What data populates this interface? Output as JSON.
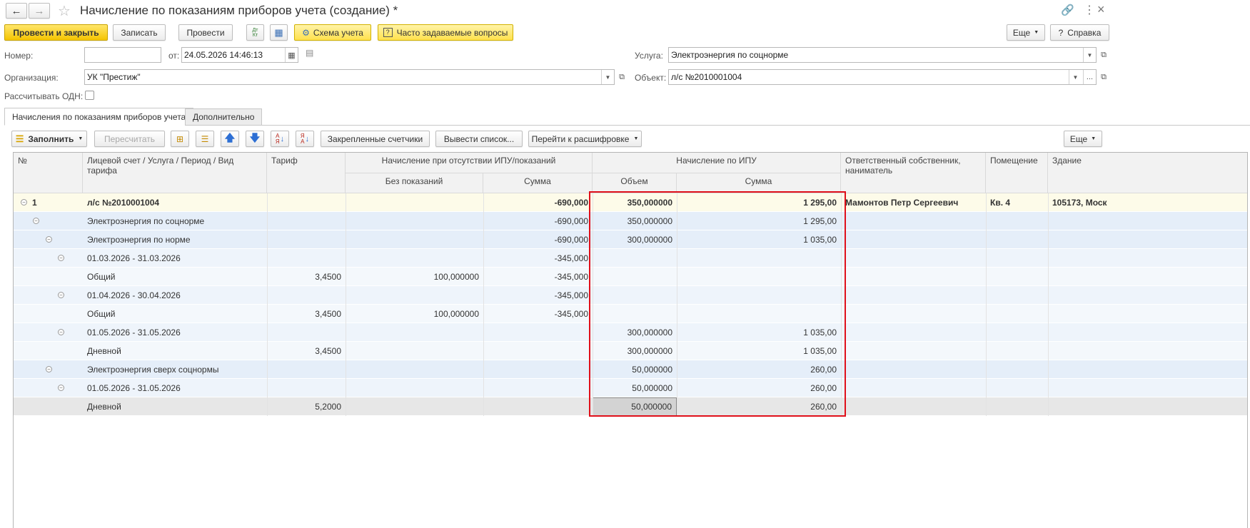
{
  "window": {
    "title": "Начисление по показаниям приборов учета (создание) *"
  },
  "toolbar": {
    "post_close": "Провести и закрыть",
    "save": "Записать",
    "post": "Провести",
    "scheme": "Схема учета",
    "faq": "Часто задаваемые вопросы",
    "more": "Еще",
    "help": "Справка"
  },
  "form": {
    "number_label": "Номер:",
    "number_value": "",
    "date_label": "от:",
    "date_value": "24.05.2026 14:46:13",
    "org_label": "Организация:",
    "org_value": "УК \"Престиж\"",
    "odn_label": "Рассчитывать ОДН:",
    "service_label": "Услуга:",
    "service_value": "Электроэнергия по соцнорме",
    "object_label": "Объект:",
    "object_value": "л/с №2010001004"
  },
  "tabs": [
    "Начисления по показаниям приборов учета",
    "Дополнительно"
  ],
  "table_toolbar": {
    "fill": "Заполнить",
    "recalc": "Пересчитать",
    "fixed_meters": "Закрепленные счетчики",
    "export_list": "Вывести список...",
    "go_decode": "Перейти к расшифровке",
    "more": "Еще"
  },
  "columns": {
    "num": "№",
    "account": "Лицевой счет / Услуга / Период / Вид тарифа",
    "tariff": "Тариф",
    "group_no_meter": "Начисление при отсутствии ИПУ/показаний",
    "no_readings": "Без показаний",
    "sum1": "Сумма",
    "group_ipu": "Начисление по ИПУ",
    "volume": "Объем",
    "sum2": "Сумма",
    "owner": "Ответственный собственник, наниматель",
    "room": "Помещение",
    "building": "Здание"
  },
  "rows": [
    {
      "num": "1",
      "text": "л/с №2010001004",
      "tariff": "",
      "no_readings": "",
      "sum1": "-690,000",
      "volume": "350,000000",
      "sum2": "1 295,00",
      "owner": "Мамонтов Петр Сергеевич",
      "room": "Кв. 4",
      "building": "105173, Моск"
    },
    {
      "num": "",
      "text": "Электроэнергия по соцнорме",
      "tariff": "",
      "no_readings": "",
      "sum1": "-690,000",
      "volume": "350,000000",
      "sum2": "1 295,00",
      "owner": "",
      "room": "",
      "building": ""
    },
    {
      "num": "",
      "text": "Электроэнергия по норме",
      "tariff": "",
      "no_readings": "",
      "sum1": "-690,000",
      "volume": "300,000000",
      "sum2": "1 035,00",
      "owner": "",
      "room": "",
      "building": ""
    },
    {
      "num": "",
      "text": "01.03.2026 - 31.03.2026",
      "tariff": "",
      "no_readings": "",
      "sum1": "-345,000",
      "volume": "",
      "sum2": "",
      "owner": "",
      "room": "",
      "building": ""
    },
    {
      "num": "",
      "text": "Общий",
      "tariff": "3,4500",
      "no_readings": "100,000000",
      "sum1": "-345,000",
      "volume": "",
      "sum2": "",
      "owner": "",
      "room": "",
      "building": ""
    },
    {
      "num": "",
      "text": "01.04.2026 - 30.04.2026",
      "tariff": "",
      "no_readings": "",
      "sum1": "-345,000",
      "volume": "",
      "sum2": "",
      "owner": "",
      "room": "",
      "building": ""
    },
    {
      "num": "",
      "text": "Общий",
      "tariff": "3,4500",
      "no_readings": "100,000000",
      "sum1": "-345,000",
      "volume": "",
      "sum2": "",
      "owner": "",
      "room": "",
      "building": ""
    },
    {
      "num": "",
      "text": "01.05.2026 - 31.05.2026",
      "tariff": "",
      "no_readings": "",
      "sum1": "",
      "volume": "300,000000",
      "sum2": "1 035,00",
      "owner": "",
      "room": "",
      "building": ""
    },
    {
      "num": "",
      "text": "Дневной",
      "tariff": "3,4500",
      "no_readings": "",
      "sum1": "",
      "volume": "300,000000",
      "sum2": "1 035,00",
      "owner": "",
      "room": "",
      "building": ""
    },
    {
      "num": "",
      "text": "Электроэнергия сверх соцнормы",
      "tariff": "",
      "no_readings": "",
      "sum1": "",
      "volume": "50,000000",
      "sum2": "260,00",
      "owner": "",
      "room": "",
      "building": ""
    },
    {
      "num": "",
      "text": "01.05.2026 - 31.05.2026",
      "tariff": "",
      "no_readings": "",
      "sum1": "",
      "volume": "50,000000",
      "sum2": "260,00",
      "owner": "",
      "room": "",
      "building": ""
    },
    {
      "num": "",
      "text": "Дневной",
      "tariff": "5,2000",
      "no_readings": "",
      "sum1": "",
      "volume": "50,000000",
      "sum2": "260,00",
      "owner": "",
      "room": "",
      "building": ""
    }
  ],
  "colors": {
    "highlight_box": "#e0101a",
    "row_blue": "#e5eef9",
    "row_top": "#fdfbe9",
    "row_selected": "#e7e7e7",
    "yellow_button": "#f5c400"
  }
}
